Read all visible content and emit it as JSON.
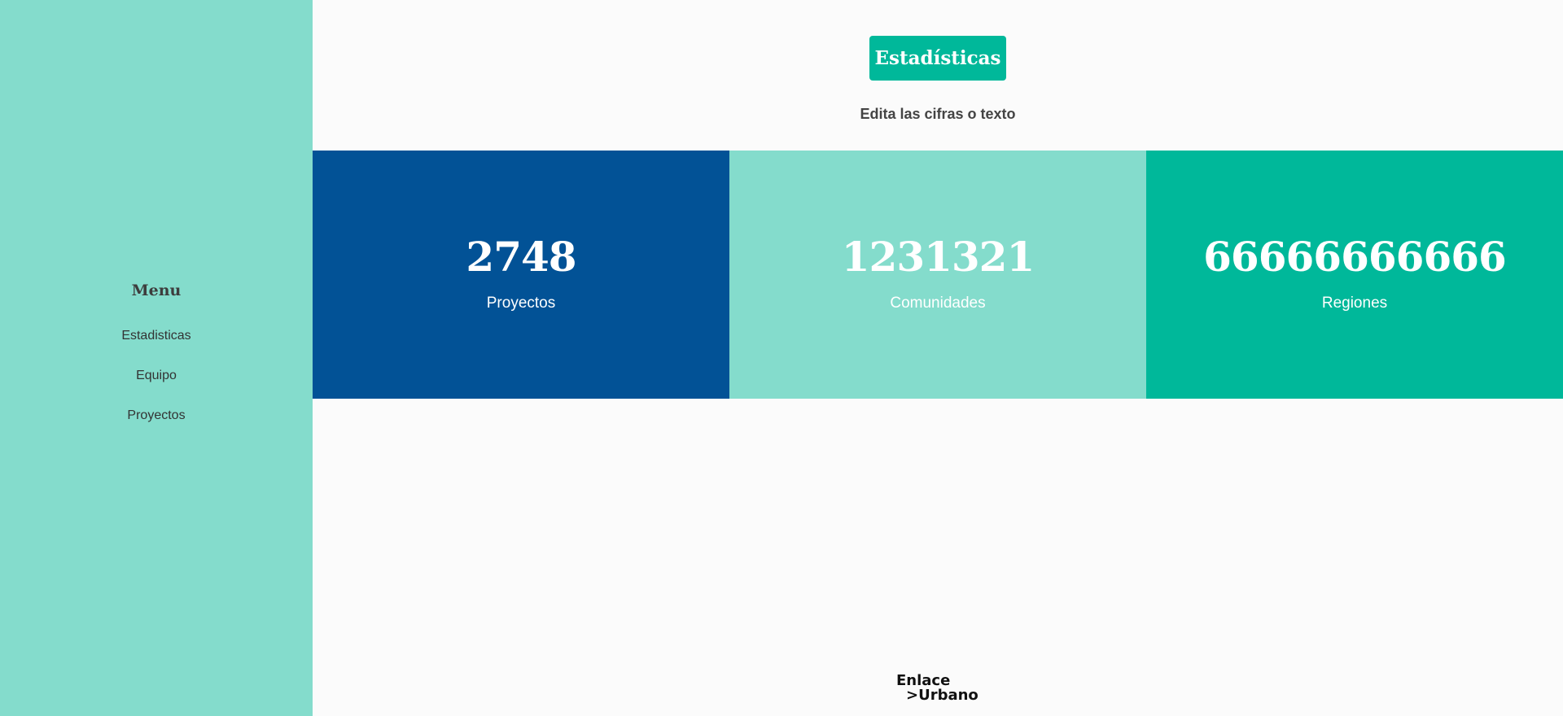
{
  "sidebar": {
    "menu_title": "Menu",
    "items": [
      {
        "label": "Estadisticas"
      },
      {
        "label": "Equipo"
      },
      {
        "label": "Proyectos"
      }
    ],
    "background": "#84dccc"
  },
  "header": {
    "title": "Estadísticas",
    "subtitle": "Edita las cifras o texto",
    "accent": "#00b89a"
  },
  "stats": [
    {
      "value": "2748",
      "label": "Proyectos",
      "color": "#025296"
    },
    {
      "value": "1231321",
      "label": "Comunidades",
      "color": "#84dccc"
    },
    {
      "value": "66666666666",
      "label": "Regiones",
      "color": "#00b89a"
    }
  ],
  "footer": {
    "logo_line1": "Enlace",
    "logo_line2": ">Urbano"
  }
}
